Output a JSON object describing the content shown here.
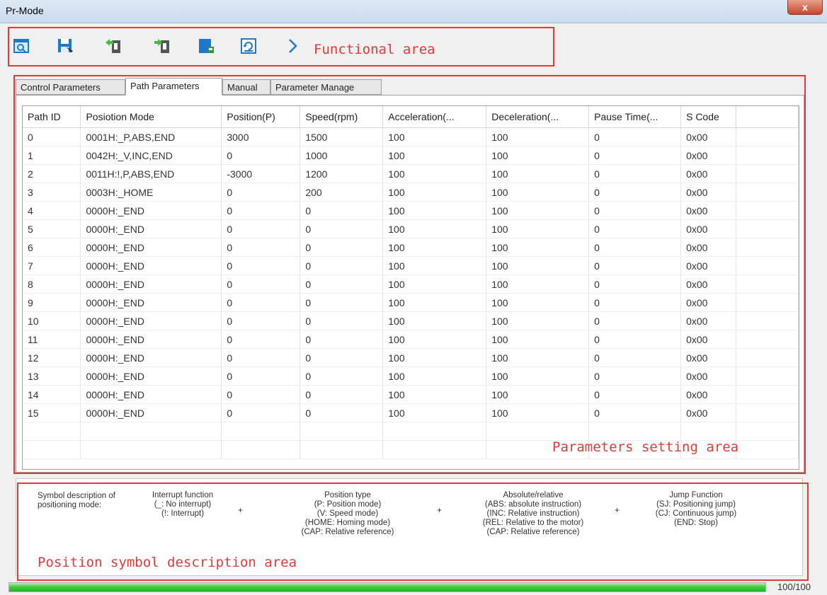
{
  "window": {
    "title": "Pr-Mode",
    "close_label": "x"
  },
  "toolbar": {
    "buttons": [
      "open-icon",
      "save-icon",
      "upload-icon",
      "download-icon",
      "write-icon",
      "refresh-icon",
      "expand-icon"
    ],
    "annotation": "Functional area"
  },
  "tabs": [
    "Control Parameters",
    "Path Parameters",
    "Manual",
    "Parameter Manage"
  ],
  "active_tab": "Path Parameters",
  "table": {
    "headers": [
      "Path ID",
      "Posiotion Mode",
      "Position(P)",
      "Speed(rpm)",
      "Acceleration(...",
      "Deceleration(...",
      "Pause Time(...",
      "S Code"
    ],
    "rows": [
      [
        "0",
        "0001H:_P,ABS,END",
        "3000",
        "1500",
        "100",
        "100",
        "0",
        "0x00"
      ],
      [
        "1",
        "0042H:_V,INC,END",
        "0",
        "1000",
        "100",
        "100",
        "0",
        "0x00"
      ],
      [
        "2",
        "0011H:!,P,ABS,END",
        "-3000",
        "1200",
        "100",
        "100",
        "0",
        "0x00"
      ],
      [
        "3",
        "0003H:_HOME",
        "0",
        "200",
        "100",
        "100",
        "0",
        "0x00"
      ],
      [
        "4",
        "0000H:_END",
        "0",
        "0",
        "100",
        "100",
        "0",
        "0x00"
      ],
      [
        "5",
        "0000H:_END",
        "0",
        "0",
        "100",
        "100",
        "0",
        "0x00"
      ],
      [
        "6",
        "0000H:_END",
        "0",
        "0",
        "100",
        "100",
        "0",
        "0x00"
      ],
      [
        "7",
        "0000H:_END",
        "0",
        "0",
        "100",
        "100",
        "0",
        "0x00"
      ],
      [
        "8",
        "0000H:_END",
        "0",
        "0",
        "100",
        "100",
        "0",
        "0x00"
      ],
      [
        "9",
        "0000H:_END",
        "0",
        "0",
        "100",
        "100",
        "0",
        "0x00"
      ],
      [
        "10",
        "0000H:_END",
        "0",
        "0",
        "100",
        "100",
        "0",
        "0x00"
      ],
      [
        "11",
        "0000H:_END",
        "0",
        "0",
        "100",
        "100",
        "0",
        "0x00"
      ],
      [
        "12",
        "0000H:_END",
        "0",
        "0",
        "100",
        "100",
        "0",
        "0x00"
      ],
      [
        "13",
        "0000H:_END",
        "0",
        "0",
        "100",
        "100",
        "0",
        "0x00"
      ],
      [
        "14",
        "0000H:_END",
        "0",
        "0",
        "100",
        "100",
        "0",
        "0x00"
      ],
      [
        "15",
        "0000H:_END",
        "0",
        "0",
        "100",
        "100",
        "0",
        "0x00"
      ]
    ],
    "annotation": "Parameters setting area"
  },
  "legend": {
    "intro": "Symbol description of\npositioning mode:",
    "groups": [
      {
        "title": "Interrupt function",
        "lines": [
          "(_: No interrupt)",
          "(!: Interrupt)"
        ]
      },
      {
        "title": "Position type",
        "lines": [
          "(P: Position mode)",
          "(V: Speed mode)",
          "(HOME: Homing mode)",
          "(CAP: Relative reference)"
        ]
      },
      {
        "title": "Absolute/relative",
        "lines": [
          "(ABS: absolute instruction)",
          "(INC: Relative instruction)",
          "(REL: Relative to the motor)",
          "(CAP: Relative reference)"
        ]
      },
      {
        "title": "Jump Function",
        "lines": [
          "(SJ: Positioning jump)",
          "(CJ: Continuous jump)",
          "(END: Stop)"
        ]
      }
    ],
    "plus": "+",
    "annotation": "Position symbol description area"
  },
  "progress": {
    "value": 100,
    "max": 100,
    "text": "100/100"
  },
  "colors": {
    "annotation": "#e03a3a",
    "progress": "#3fcf3f",
    "icon_blue": "#1e78c8"
  }
}
